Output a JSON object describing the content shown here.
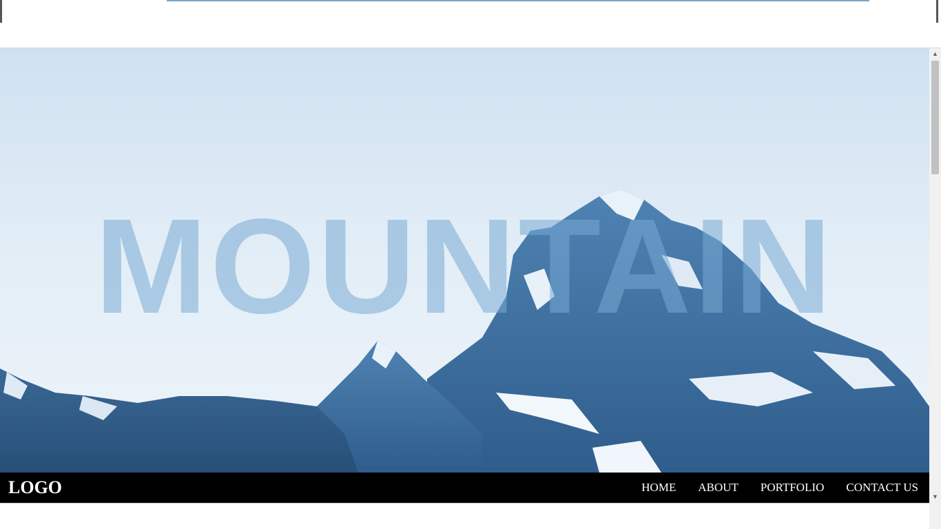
{
  "hero": {
    "title": "MOUNTAIN"
  },
  "navbar": {
    "logo": "LOGO",
    "links": [
      {
        "label": "HOME"
      },
      {
        "label": "ABOUT"
      },
      {
        "label": "PORTFOLIO"
      },
      {
        "label": "CONTACT US"
      }
    ]
  },
  "colors": {
    "navbar_bg": "#000000",
    "nav_text": "#ffffff",
    "title_overlay": "#78aad4",
    "sky": "#e6f0f8"
  },
  "icons": {
    "scroll_up": "triangle-up-icon",
    "scroll_down": "triangle-down-icon"
  }
}
